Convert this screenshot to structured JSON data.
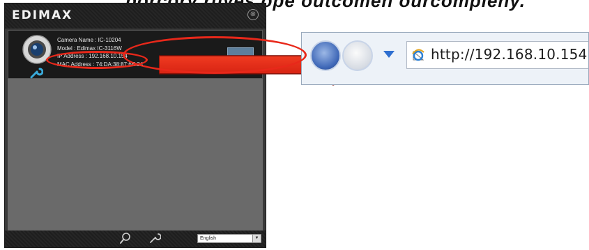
{
  "caption": "porcory ruyes ope outcomen ourcompleny.",
  "edimax_window": {
    "logo": "EDIMAX",
    "close_symbol": "⊗",
    "camera": {
      "name_line": "Camera Name : IC-10204",
      "model_line": "Model : Edimax IC-3116W",
      "ip_line": "IP Address : 192.168.10.154",
      "mac_line": "MAC Address : 74:DA:38:87:6E:34"
    },
    "language": "English"
  },
  "browser": {
    "url": "http://192.168.10.154"
  },
  "colors": {
    "highlight": "#e8281a",
    "window_bg": "#3a3a3a",
    "list_bg": "#6a6a6a"
  },
  "icons": {
    "camera": "camera-icon",
    "wrench": "wrench-icon",
    "search": "search-icon",
    "settings": "settings-icon",
    "ie": "ie-icon"
  }
}
